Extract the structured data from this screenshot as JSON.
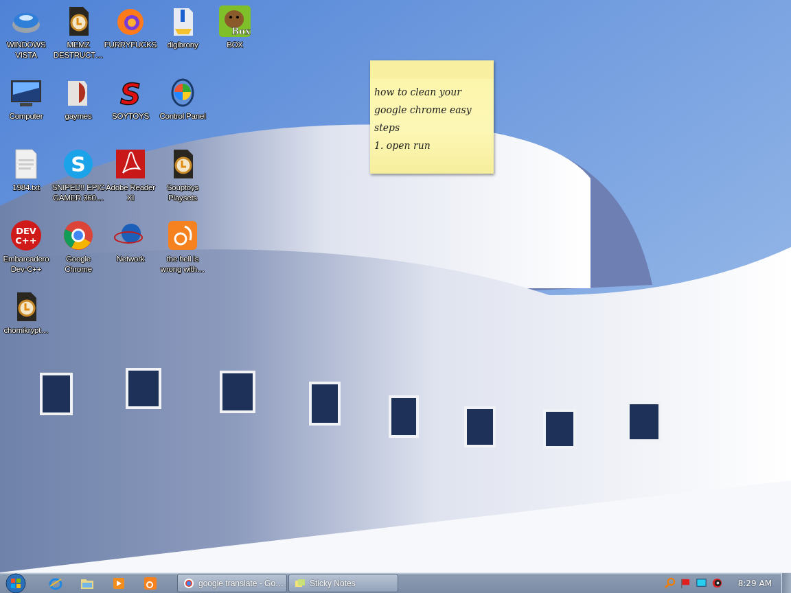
{
  "icon_rows": [
    {
      "icons": [
        {
          "label": "WINDOWS VISTA"
        },
        {
          "label": "MEMZ DESTRUCT…"
        },
        {
          "label": "FURRYFUCKS"
        },
        {
          "label": "digibrony"
        },
        {
          "label": "BOX",
          "badge": "Box"
        }
      ]
    },
    {
      "icons": [
        {
          "label": "Computer"
        },
        {
          "label": "gaymes"
        },
        {
          "label": "SOYTOYS",
          "badge": "S"
        },
        {
          "label": "Control Panel"
        }
      ]
    },
    {
      "icons": [
        {
          "label": "1984.txt"
        },
        {
          "label": "SNIPED!! EPIC GAMER 360…",
          "badge": "S"
        },
        {
          "label": "Adobe Reader XI"
        },
        {
          "label": "Souptoys Playsets"
        }
      ]
    },
    {
      "icons": [
        {
          "label": "Embarcadero Dev-C++",
          "badge": "DEV C++"
        },
        {
          "label": "Google Chrome"
        },
        {
          "label": "Network"
        },
        {
          "label": "the hell is wrong with…"
        }
      ]
    },
    {
      "icons": [
        {
          "label": "chomikrypt…"
        }
      ]
    }
  ],
  "sticky_note": {
    "lines": [
      "how to clean your",
      "google chrome easy",
      "steps",
      "1. open run"
    ]
  },
  "taskbar": {
    "tasks": [
      {
        "label": "google translate - Go…"
      },
      {
        "label": "Sticky Notes"
      }
    ],
    "clock": "8:29 AM"
  }
}
